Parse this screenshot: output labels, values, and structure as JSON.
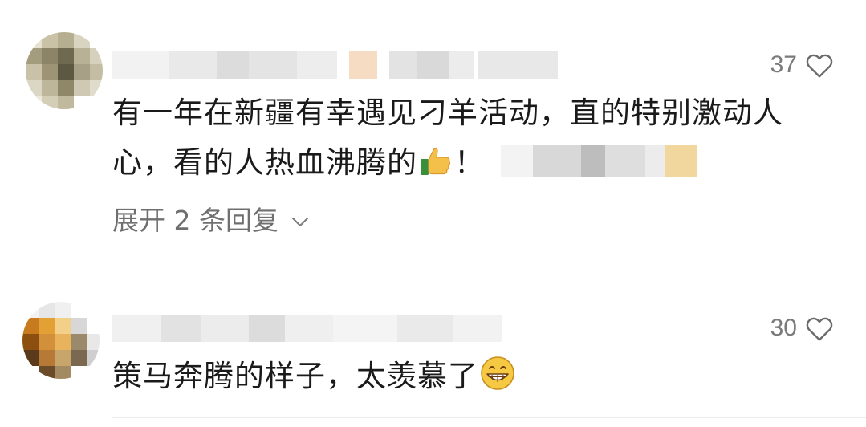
{
  "comments": [
    {
      "username": "",
      "likes": "37",
      "content_line1": "有一年在新疆有幸遇见刁羊活动，直的特别激动人",
      "content_line2": "心，看的人热血沸腾的",
      "content_after_emoji": "！",
      "emoji": "thumbs-up-icon",
      "expand_label": "展开 2 条回复"
    },
    {
      "username": "",
      "likes": "30",
      "content": "策马奔腾的样子，太羡慕了",
      "emoji": "grinning-face-icon"
    }
  ],
  "colors": {
    "text": "#1a1a1a",
    "meta": "#7a7a7a",
    "expand": "#6f6f6f",
    "divider": "#ececec"
  }
}
